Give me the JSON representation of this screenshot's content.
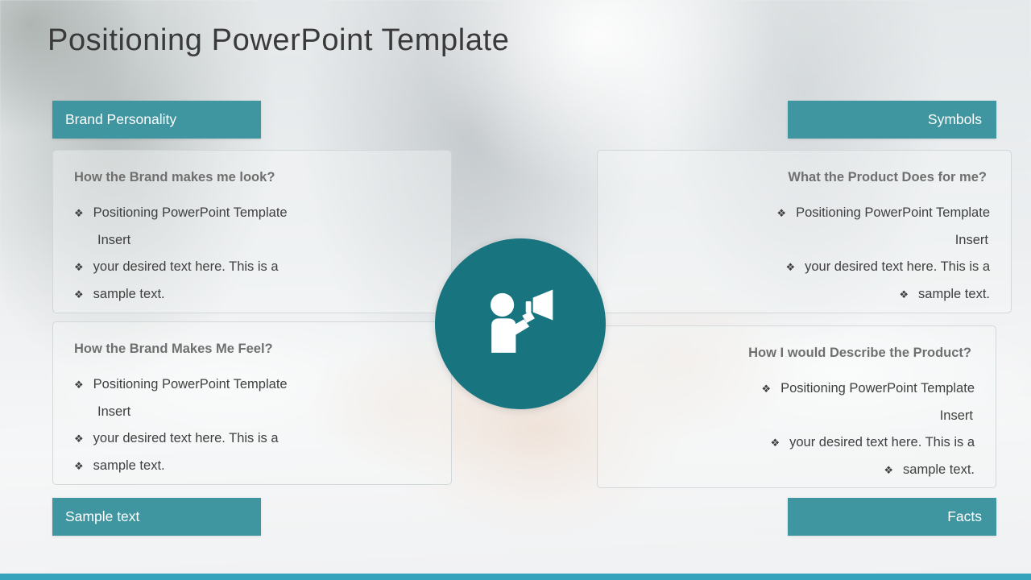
{
  "slide": {
    "title": "Positioning PowerPoint Template",
    "accent_color": "#3f95a0",
    "icon_circle_color": "#18757f",
    "bottom_strip_color": "#35a3bb",
    "heading_color": "#6f6f6f",
    "body_text_color": "#3f3f3f"
  },
  "bars": {
    "brand_personality": "Brand Personality",
    "symbols": "Symbols",
    "sample_text": "Sample text",
    "facts": "Facts"
  },
  "panels": {
    "top_left": {
      "heading": "How the Brand makes me look?",
      "bullet_marker": "❖",
      "lines": [
        {
          "marker": true,
          "text": "Positioning PowerPoint Template"
        },
        {
          "marker": false,
          "text": "Insert"
        },
        {
          "marker": true,
          "text": "your desired text here. This is a"
        },
        {
          "marker": true,
          "text": "sample text."
        }
      ]
    },
    "bottom_left": {
      "heading": "How the Brand Makes Me Feel?",
      "bullet_marker": "❖",
      "lines": [
        {
          "marker": true,
          "text": "Positioning PowerPoint Template"
        },
        {
          "marker": false,
          "text": "Insert"
        },
        {
          "marker": true,
          "text": "your desired text here. This is a"
        },
        {
          "marker": true,
          "text": "sample text."
        }
      ]
    },
    "top_right": {
      "heading": "What the Product Does for me?",
      "bullet_marker": "❖",
      "lines": [
        {
          "marker": true,
          "text": "Positioning PowerPoint Template"
        },
        {
          "marker": false,
          "text": "Insert"
        },
        {
          "marker": true,
          "text": "your desired text here. This is a"
        },
        {
          "marker": true,
          "text": "sample text."
        }
      ]
    },
    "bottom_right": {
      "heading": "How I would Describe the Product?",
      "bullet_marker": "❖",
      "lines": [
        {
          "marker": true,
          "text": "Positioning PowerPoint Template"
        },
        {
          "marker": false,
          "text": "Insert"
        },
        {
          "marker": true,
          "text": "your desired text here. This is a"
        },
        {
          "marker": true,
          "text": "sample text."
        }
      ]
    }
  },
  "center_icon": {
    "name": "person-with-megaphone-icon"
  }
}
